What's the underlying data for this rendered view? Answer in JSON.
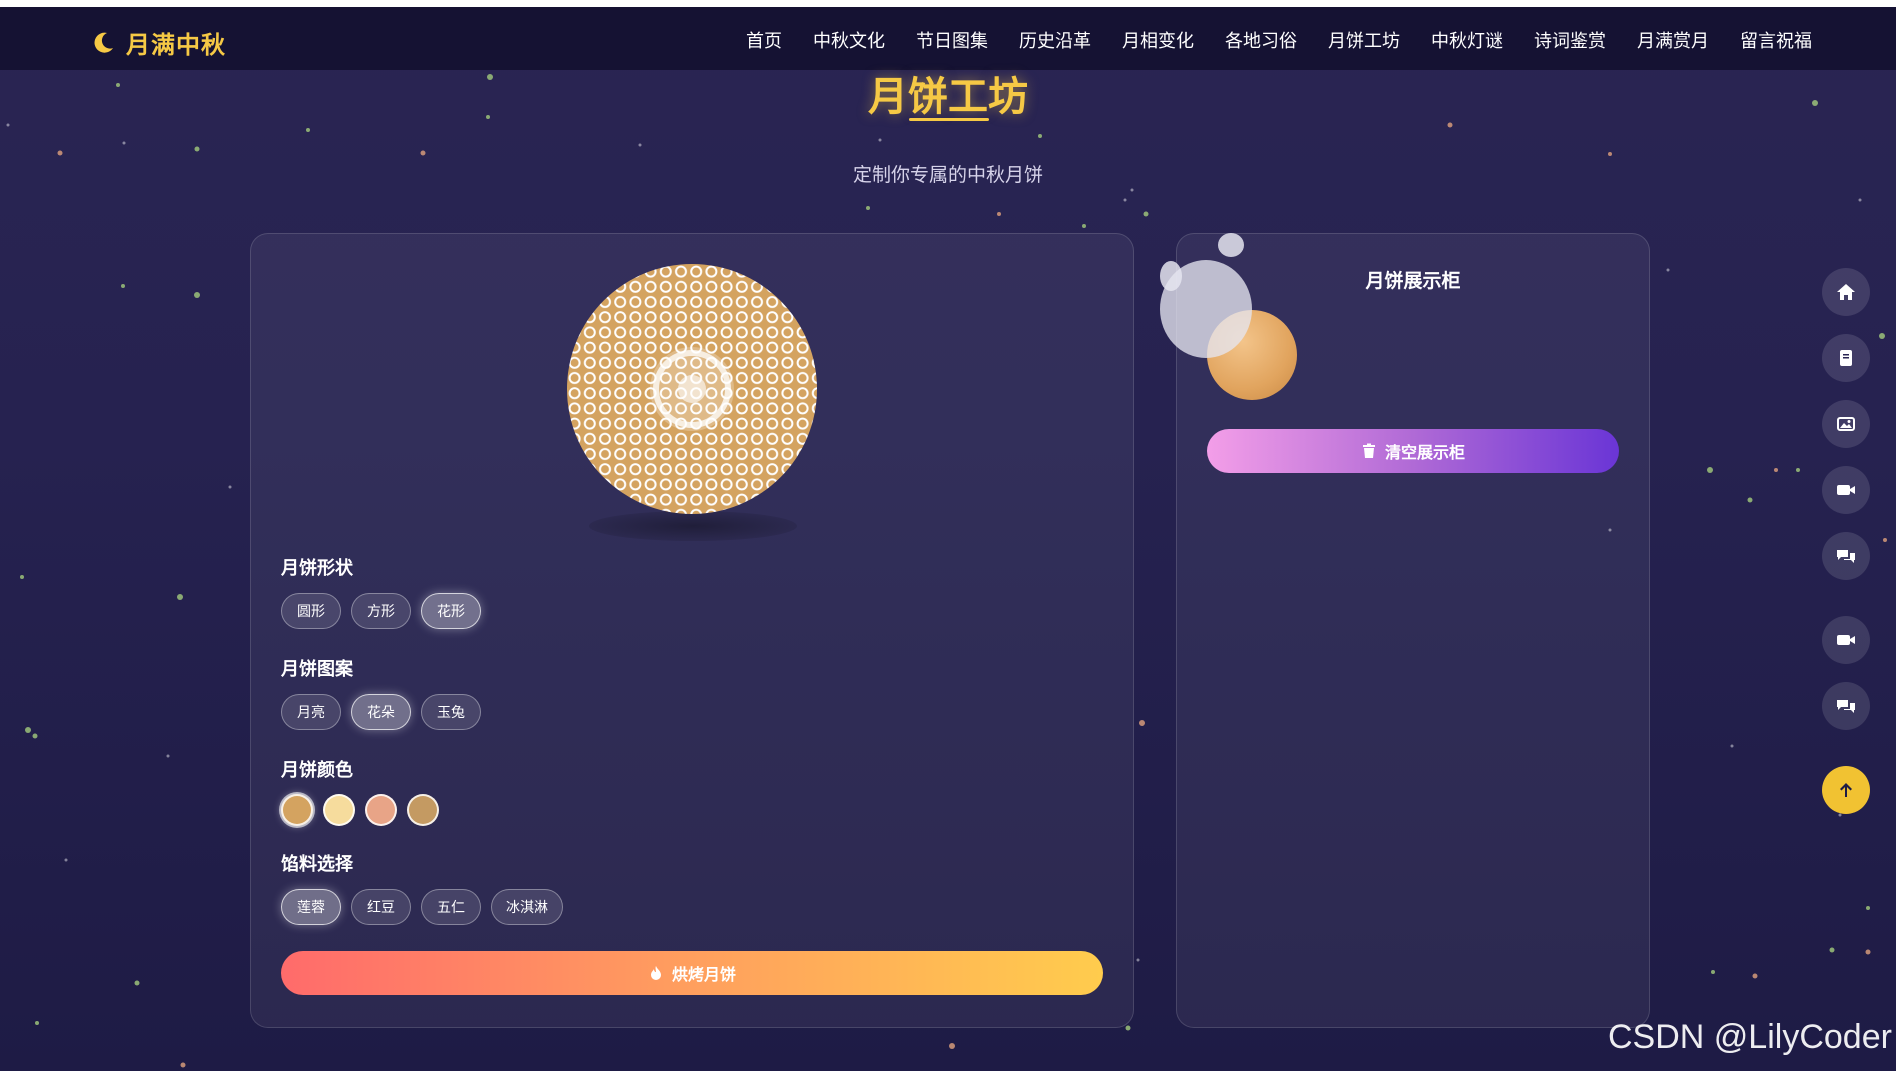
{
  "brand": {
    "name": "月满中秋",
    "icon": "moon-icon",
    "color": "#f6c945"
  },
  "nav": {
    "items": [
      "首页",
      "中秋文化",
      "节日图集",
      "历史沿革",
      "月相变化",
      "各地习俗",
      "月饼工坊",
      "中秋灯谜",
      "诗词鉴赏",
      "月满赏月",
      "留言祝福"
    ]
  },
  "section": {
    "title": "月饼工坊",
    "subtitle": "定制你专属的中秋月饼"
  },
  "workshop": {
    "shape": {
      "label": "月饼形状",
      "options": [
        "圆形",
        "方形",
        "花形"
      ],
      "selected": "花形"
    },
    "pattern": {
      "label": "月饼图案",
      "options": [
        "月亮",
        "花朵",
        "玉兔"
      ],
      "selected": "花朵"
    },
    "color": {
      "label": "月饼颜色",
      "swatches": [
        "#d4a360",
        "#f6dc9d",
        "#e8a487",
        "#c49a62"
      ],
      "selected": "#d4a360"
    },
    "filling": {
      "label": "馅料选择",
      "options": [
        "莲蓉",
        "红豆",
        "五仁",
        "冰淇淋"
      ],
      "selected": "莲蓉"
    },
    "bake_button": {
      "label": "烘烤月饼",
      "icon": "fire-icon"
    }
  },
  "showcase": {
    "title": "月饼展示柜",
    "clear_button": {
      "label": "清空展示柜",
      "icon": "trash-icon"
    }
  },
  "side_dock": {
    "icons": [
      "home-icon",
      "book-icon",
      "images-icon",
      "video-icon",
      "comments-icon",
      "video-icon",
      "comments-icon"
    ],
    "top_button_icon": "arrow-up-icon"
  },
  "watermark": "CSDN @LilyCoder"
}
